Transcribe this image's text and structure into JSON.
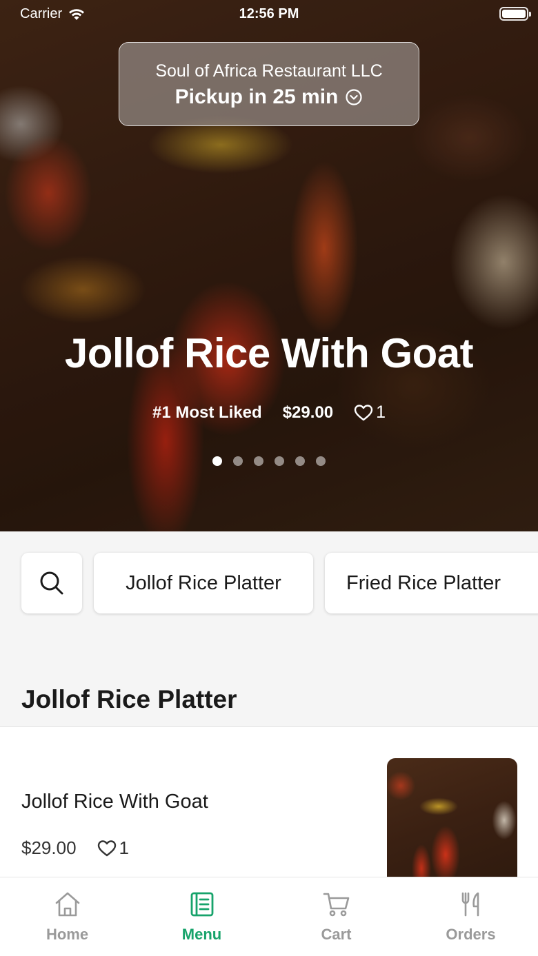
{
  "status_bar": {
    "carrier": "Carrier",
    "time": "12:56 PM"
  },
  "header": {
    "restaurant_name": "Soul of Africa Restaurant LLC",
    "pickup_label": "Pickup in 25 min"
  },
  "hero": {
    "title": "Jollof Rice With Goat",
    "badge": "#1 Most Liked",
    "price": "$29.00",
    "likes": "1",
    "slide_count": 6,
    "active_slide": 0
  },
  "categories": {
    "search_icon": "search-icon",
    "items": [
      "Jollof Rice Platter",
      "Fried Rice Platter"
    ]
  },
  "section": {
    "title": "Jollof Rice Platter",
    "items": [
      {
        "name": "Jollof Rice With Goat",
        "price": "$29.00",
        "likes": "1"
      }
    ]
  },
  "tabbar": {
    "tabs": [
      {
        "label": "Home",
        "icon": "home-icon"
      },
      {
        "label": "Menu",
        "icon": "menu-icon"
      },
      {
        "label": "Cart",
        "icon": "cart-icon"
      },
      {
        "label": "Orders",
        "icon": "orders-icon"
      }
    ],
    "active_index": 1
  },
  "colors": {
    "accent": "#17a36b",
    "inactive": "#9a9a9a"
  }
}
